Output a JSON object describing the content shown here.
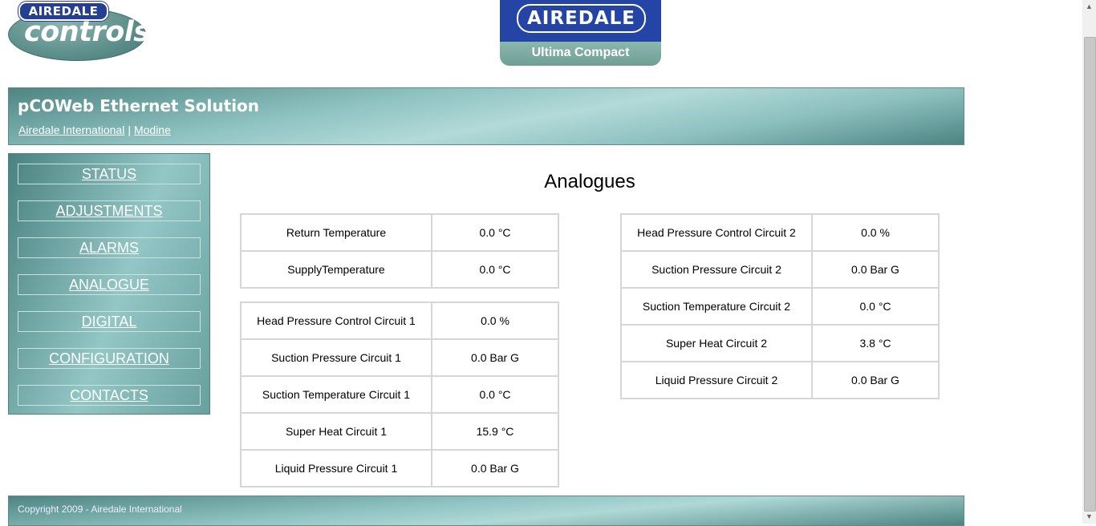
{
  "logos": {
    "controls_badge": "AIREDALE",
    "controls_word": "controls",
    "main_brand": "AIREDALE",
    "main_product": "Ultima Compact"
  },
  "header": {
    "title": "pCOWeb Ethernet Solution",
    "links": [
      "Airedale International",
      "Modine"
    ],
    "separator": "|"
  },
  "sidebar": {
    "items": [
      "STATUS",
      "ADJUSTMENTS",
      "ALARMS",
      "ANALOGUE",
      "DIGITAL",
      "CONFIGURATION",
      "CONTACTS"
    ]
  },
  "main": {
    "heading": "Analogues",
    "table_general": [
      {
        "label": "Return Temperature",
        "value": "0.0 °C"
      },
      {
        "label": "SupplyTemperature",
        "value": "0.0 °C"
      }
    ],
    "table_circuit1": [
      {
        "label": "Head Pressure Control Circuit 1",
        "value": "0.0 %"
      },
      {
        "label": "Suction Pressure Circuit 1",
        "value": "0.0 Bar G"
      },
      {
        "label": "Suction Temperature Circuit 1",
        "value": "0.0 °C"
      },
      {
        "label": "Super Heat Circuit 1",
        "value": "15.9 °C"
      },
      {
        "label": "Liquid Pressure Circuit 1",
        "value": "0.0 Bar G"
      }
    ],
    "table_circuit2": [
      {
        "label": "Head Pressure Control Circuit 2",
        "value": "0.0 %"
      },
      {
        "label": "Suction Pressure Circuit 2",
        "value": "0.0 Bar G"
      },
      {
        "label": "Suction Temperature Circuit 2",
        "value": "0.0 °C"
      },
      {
        "label": "Super Heat Circuit 2",
        "value": "3.8 °C"
      },
      {
        "label": "Liquid Pressure Circuit 2",
        "value": "0.0 Bar G"
      }
    ]
  },
  "footer": {
    "copyright": "Copyright 2009 - Airedale International"
  },
  "colors": {
    "teal_dark": "#4e8583",
    "teal_light": "#b2dad8",
    "brand_blue": "#2545a6"
  }
}
